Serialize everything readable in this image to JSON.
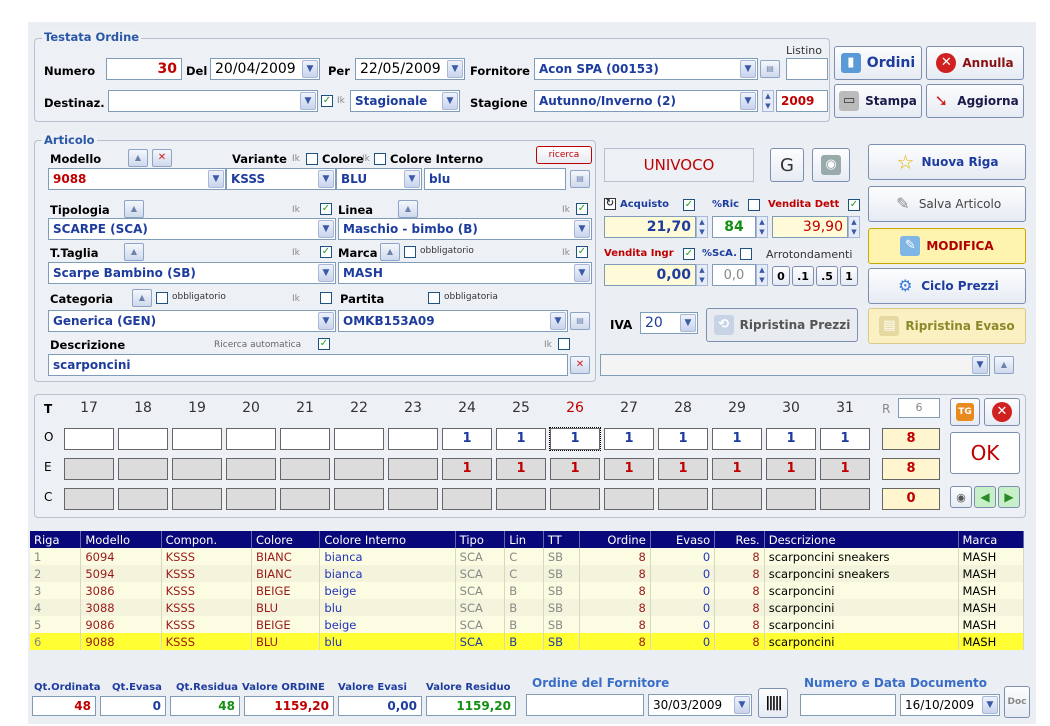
{
  "header": {
    "title": "Testata Ordine",
    "numero_label": "Numero",
    "numero": "30",
    "del_label": "Del",
    "del_date": "20/04/2009",
    "per_label": "Per",
    "per_date": "22/05/2009",
    "fornitore_label": "Fornitore",
    "fornitore": "Acon SPA  (00153)",
    "listino_label": "Listino",
    "listino": "",
    "destinaz_label": "Destinaz.",
    "destinaz": "",
    "ik": "Ik",
    "stagionale": "Stagionale",
    "stagione_label": "Stagione",
    "stagione": "Autunno/Inverno  (2)",
    "anno": "2009"
  },
  "buttons": {
    "ordini": "Ordini",
    "annulla": "Annulla",
    "stampa": "Stampa",
    "aggiorna": "Aggiorna",
    "nuova_riga": "Nuova Riga",
    "salva": "Salva Articolo",
    "modifica": "MODIFICA",
    "ciclo": "Ciclo Prezzi",
    "ripristina_prezzi": "Ripristina Prezzi",
    "ripristina_evaso": "Ripristina Evaso",
    "ricerca": "ricerca",
    "ok": "OK",
    "g": "G"
  },
  "articolo": {
    "title": "Articolo",
    "modello_label": "Modello",
    "modello": "9088",
    "variante_label": "Variante",
    "variante": "KSSS",
    "colore_label": "Colore",
    "colore": "BLU",
    "colore_int_label": "Colore Interno",
    "colore_int": "blu",
    "univoco": "UNIVOCO",
    "tipologia_label": "Tipologia",
    "tipologia": "SCARPE  (SCA)",
    "linea_label": "Linea",
    "linea": "Maschio - bimbo  (B)",
    "ttaglia_label": "T.Taglia",
    "ttaglia": "Scarpe Bambino  (SB)",
    "marca_label": "Marca",
    "marca": "MASH",
    "categoria_label": "Categoria",
    "categoria": "Generica  (GEN)",
    "partita_label": "Partita",
    "partita": "OMKB153A09",
    "obbligatorio": "obbligatorio",
    "obbligatoria": "obbligatoria",
    "descrizione_label": "Descrizione",
    "descrizione": "scarponcini",
    "ricerca_auto": "Ricerca automatica"
  },
  "prezzi": {
    "acquisto_label": "Acquisto",
    "acquisto": "21,70",
    "ric_label": "%Ric",
    "ric": "84",
    "vendita_dett_label": "Vendita Dett",
    "vendita_dett": "39,90",
    "vendita_ingr_label": "Vendita Ingr",
    "vendita_ingr": "0,00",
    "sca_label": "%ScA.",
    "sca": "0,0",
    "arrot_label": "Arrotondamenti",
    "arrot": [
      "0",
      ".1",
      ".5",
      "1"
    ],
    "iva_label": "IVA",
    "iva": "20"
  },
  "taglie": {
    "rows": [
      "T",
      "O",
      "E",
      "C"
    ],
    "sizes": [
      "17",
      "18",
      "19",
      "20",
      "21",
      "22",
      "23",
      "24",
      "25",
      "26",
      "27",
      "28",
      "29",
      "30",
      "31"
    ],
    "o": [
      "",
      "",
      "",
      "",
      "",
      "",
      "",
      "1",
      "1",
      "1",
      "1",
      "1",
      "1",
      "1",
      "1"
    ],
    "e": [
      "",
      "",
      "",
      "",
      "",
      "",
      "",
      "1",
      "1",
      "1",
      "1",
      "1",
      "1",
      "1",
      "1"
    ],
    "r_label": "R",
    "r_value": "6",
    "tot_o": "8",
    "tot_e": "8",
    "tot_c": "0"
  },
  "table": {
    "headers": [
      "Riga",
      "Modello",
      "Compon.",
      "Colore",
      "Colore Interno",
      "Tipo",
      "Lin",
      "TT",
      "Ordine",
      "Evaso",
      "Res.",
      "Descrizione",
      "Marca"
    ],
    "rows": [
      [
        "1",
        "6094",
        "KSSS",
        "BIANC",
        "bianca",
        "SCA",
        "C",
        "SB",
        "8",
        "0",
        "8",
        "scarponcini sneakers",
        "MASH"
      ],
      [
        "2",
        "5094",
        "KSSS",
        "BIANC",
        "bianca",
        "SCA",
        "C",
        "SB",
        "8",
        "0",
        "8",
        "scarponcini sneakers",
        "MASH"
      ],
      [
        "3",
        "3086",
        "KSSS",
        "BEIGE",
        "beige",
        "SCA",
        "B",
        "SB",
        "8",
        "0",
        "8",
        "scarponcini",
        "MASH"
      ],
      [
        "4",
        "3088",
        "KSSS",
        "BLU",
        "blu",
        "SCA",
        "B",
        "SB",
        "8",
        "0",
        "8",
        "scarponcini",
        "MASH"
      ],
      [
        "5",
        "9086",
        "KSSS",
        "BEIGE",
        "beige",
        "SCA",
        "B",
        "SB",
        "8",
        "0",
        "8",
        "scarponcini",
        "MASH"
      ],
      [
        "6",
        "9088",
        "KSSS",
        "BLU",
        "blu",
        "SCA",
        "B",
        "SB",
        "8",
        "0",
        "8",
        "scarponcini",
        "MASH"
      ]
    ]
  },
  "totals": {
    "qt_ord_label": "Qt.Ordinata",
    "qt_ord": "48",
    "qt_ev_label": "Qt.Evasa",
    "qt_ev": "0",
    "qt_res_label": "Qt.Residua",
    "qt_res": "48",
    "val_ord_label": "Valore ORDINE",
    "val_ord": "1159,20",
    "val_ev_label": "Valore Evasi",
    "val_ev": "0,00",
    "val_res_label": "Valore Residuo",
    "val_res": "1159,20",
    "ord_forn_label": "Ordine del Fornitore",
    "ord_forn": "",
    "ord_forn_date": "30/03/2009",
    "num_doc_label": "Numero e Data Documento",
    "num_doc": "",
    "num_doc_date": "16/10/2009",
    "doc": "Doc"
  }
}
